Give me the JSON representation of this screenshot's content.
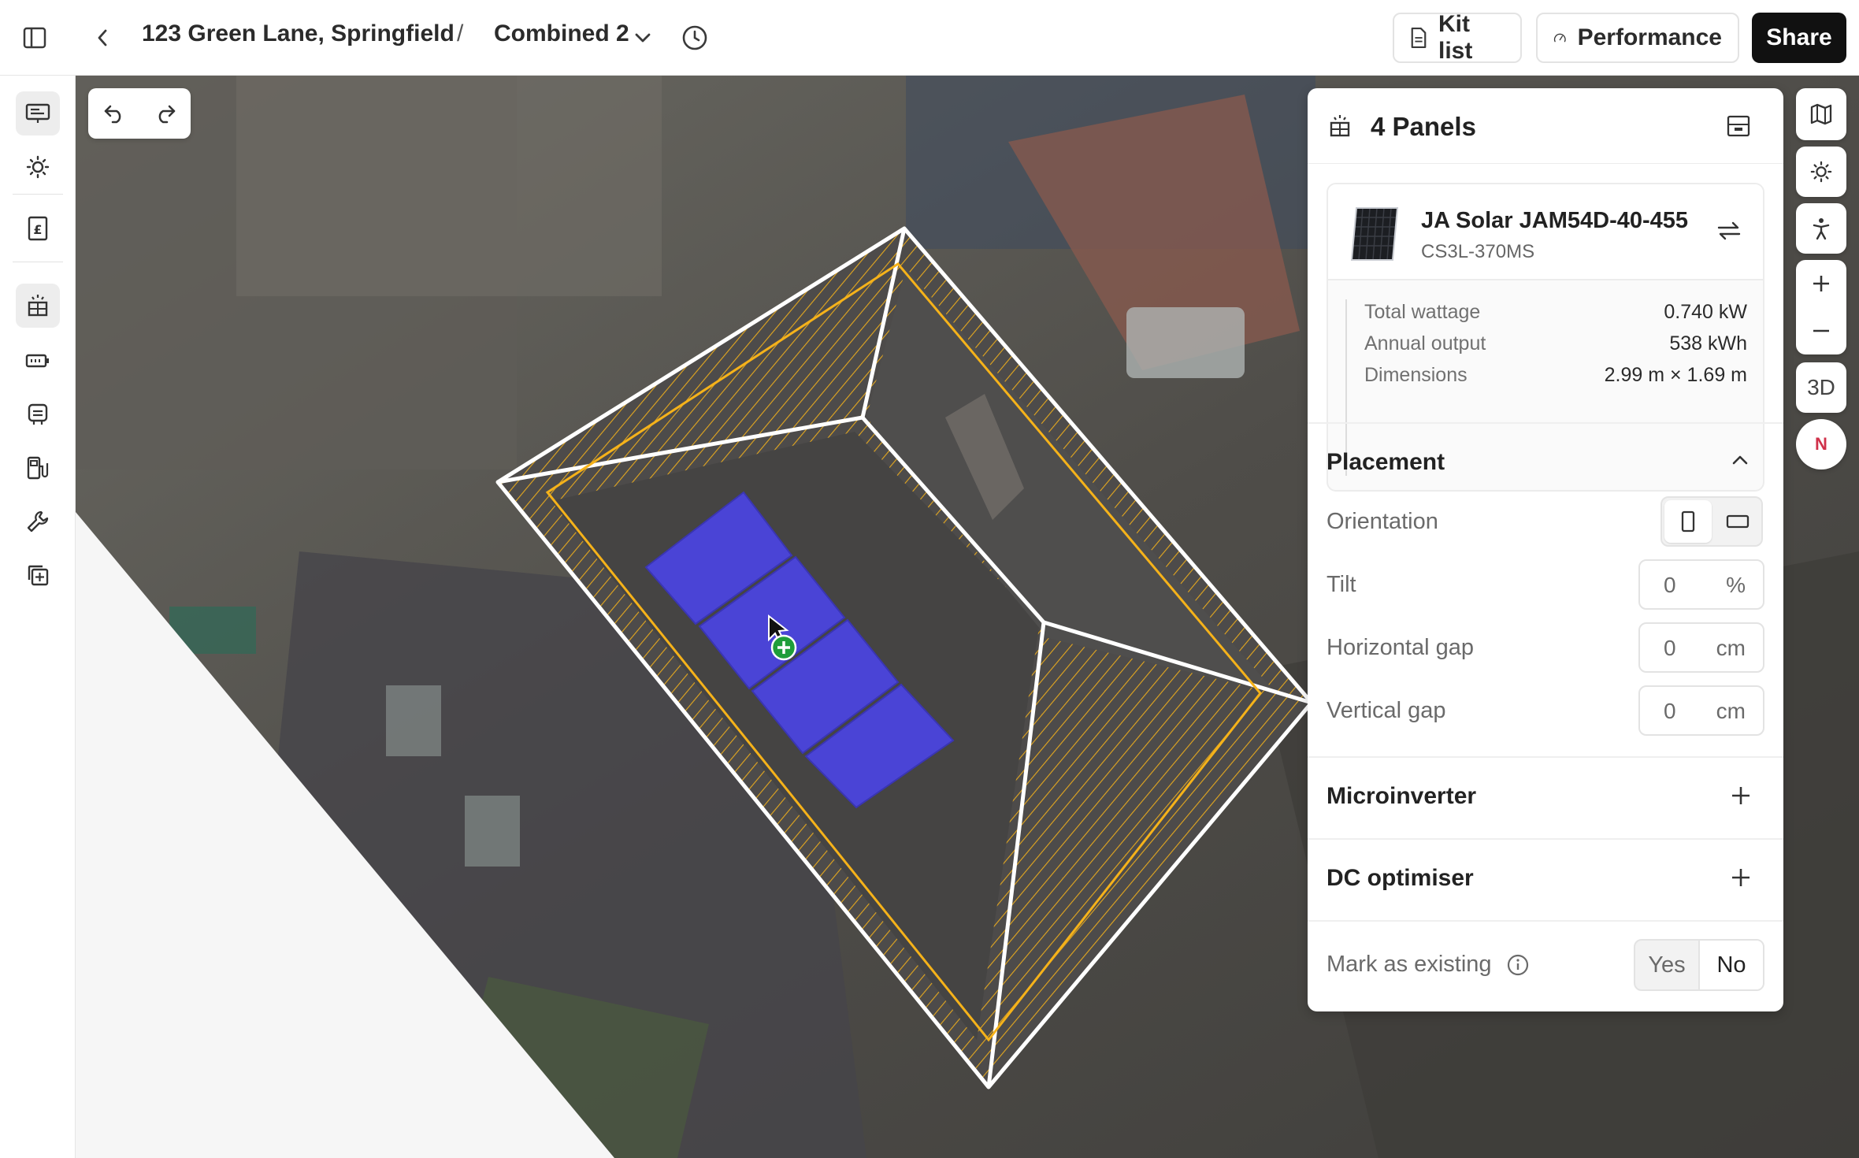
{
  "header": {
    "address": "123 Green Lane, Springfield",
    "separator": "/",
    "design_name": "Combined 2",
    "kit_list_label": "Kit list",
    "performance_label": "Performance",
    "share_label": "Share"
  },
  "sidebar": {
    "items": [
      {
        "icon": "presentation-icon",
        "active": true
      },
      {
        "icon": "sun-icon",
        "active": false
      },
      {
        "icon": "pound-receipt-icon",
        "active": false
      },
      {
        "icon": "solar-panel-icon",
        "active": true
      },
      {
        "icon": "battery-icon",
        "active": false
      },
      {
        "icon": "inverter-icon",
        "active": false
      },
      {
        "icon": "ev-charger-icon",
        "active": false
      },
      {
        "icon": "wrench-icon",
        "active": false
      },
      {
        "icon": "add-copy-icon",
        "active": false
      }
    ]
  },
  "map_controls": {
    "three_d_label": "3D",
    "compass_label": "N"
  },
  "panel": {
    "title": "4 Panels",
    "module": {
      "name": "JA Solar JAM54D-40-455",
      "subtitle": "CS3L-370MS"
    },
    "specs": [
      {
        "label": "Total wattage",
        "value": "0.740 kW"
      },
      {
        "label": "Annual output",
        "value": "538 kWh"
      },
      {
        "label": "Dimensions",
        "value": "2.99 m × 1.69 m"
      }
    ],
    "placement": {
      "title": "Placement",
      "orientation_label": "Orientation",
      "orientation_selected": "portrait",
      "tilt_label": "Tilt",
      "tilt_value": "0",
      "tilt_unit": "%",
      "hgap_label": "Horizontal gap",
      "hgap_value": "0",
      "hgap_unit": "cm",
      "vgap_label": "Vertical gap",
      "vgap_value": "0",
      "vgap_unit": "cm"
    },
    "microinverter_label": "Microinverter",
    "dc_optimiser_label": "DC optimiser",
    "mark_existing": {
      "label": "Mark as existing",
      "yes": "Yes",
      "no": "No",
      "selected": "No"
    }
  },
  "colors": {
    "panel_fill": "#4a44d6",
    "roof_outline": "#f5b21a",
    "compass_red": "#d0314a"
  }
}
